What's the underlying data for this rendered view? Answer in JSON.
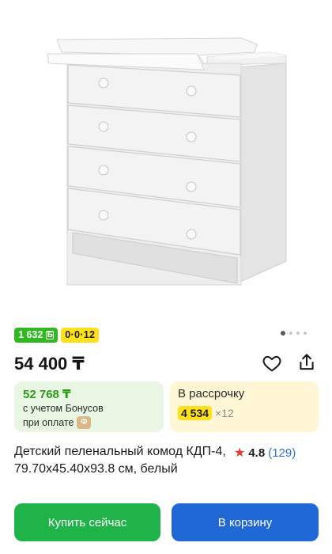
{
  "badges": {
    "bonus": "1 632",
    "bonus_icon": "Б",
    "installment": "0·0·12"
  },
  "price": "54 400 ₸",
  "icons": {
    "favorite": "heart-icon",
    "share": "share-icon"
  },
  "bonus_card": {
    "amount": "52 768 ₸",
    "line1": "с учетом Бонусов",
    "line2": "при оплате",
    "icon_glyph": "Ф"
  },
  "credit_card": {
    "title": "В рассрочку",
    "amount": "4 534",
    "multiplier": "×12"
  },
  "product": {
    "title": "Детский пеленальный комод КДП-4, 79.70x45.40x93.8 см, белый"
  },
  "rating": {
    "value": "4.8",
    "count": "(129)"
  },
  "actions": {
    "buy_now": "Купить сейчас",
    "add_to_cart": "В корзину"
  },
  "colors": {
    "bonus_green": "#2fb81f",
    "installment_yellow": "#ffe11a",
    "buy_green": "#1fb34a",
    "cart_blue": "#1f68d6",
    "star_red": "#e8392b",
    "link_blue": "#2f6fd6"
  }
}
